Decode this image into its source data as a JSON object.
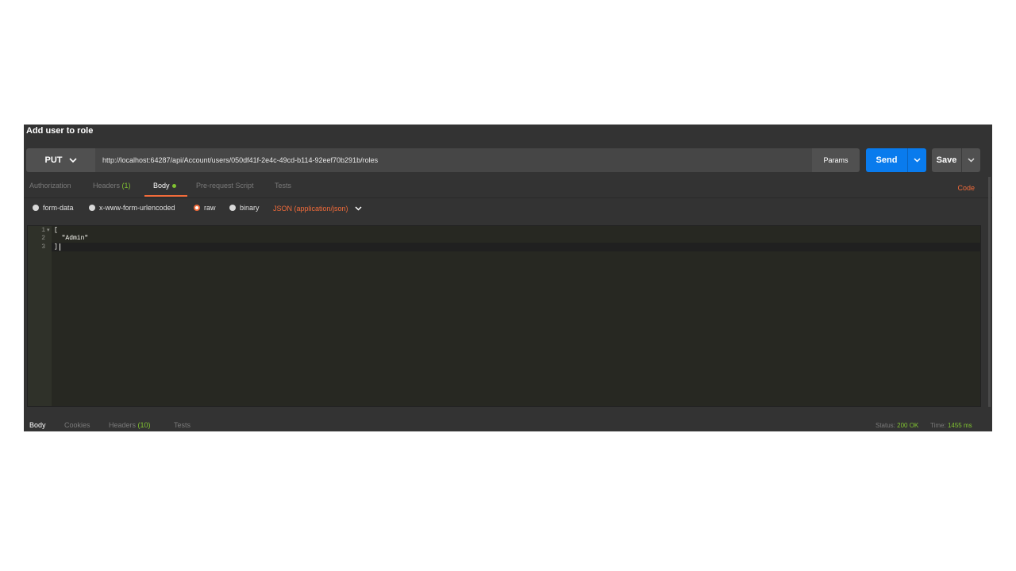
{
  "request": {
    "title": "Add user to role",
    "method": "PUT",
    "url": "http://localhost:64287/api/Account/users/050df41f-2e4c-49cd-b114-92eef70b291b/roles",
    "params_label": "Params",
    "send_label": "Send",
    "save_label": "Save"
  },
  "tabs": [
    {
      "label": "Authorization"
    },
    {
      "label": "Headers",
      "count": "(1)"
    },
    {
      "label": "Body"
    },
    {
      "label": "Pre-request Script"
    },
    {
      "label": "Tests"
    }
  ],
  "code_label": "Code",
  "body_types": [
    {
      "label": "form-data",
      "selected": false
    },
    {
      "label": "x-www-form-urlencoded",
      "selected": false
    },
    {
      "label": "raw",
      "selected": true
    },
    {
      "label": "binary",
      "selected": false
    }
  ],
  "content_type": "JSON (application/json)",
  "editor": {
    "lines": [
      {
        "num": "1",
        "text": "["
      },
      {
        "num": "2",
        "text": "  \"Admin\""
      },
      {
        "num": "3",
        "text": "]"
      }
    ]
  },
  "response": {
    "tabs": [
      {
        "label": "Body"
      },
      {
        "label": "Cookies"
      },
      {
        "label": "Headers",
        "count": "(10)"
      },
      {
        "label": "Tests"
      }
    ],
    "status_label": "Status:",
    "status_value": "200 OK",
    "time_label": "Time:",
    "time_value": "1455 ms"
  },
  "colors": {
    "accent": "#f26b3a",
    "send": "#097bed",
    "success": "#80c331"
  }
}
